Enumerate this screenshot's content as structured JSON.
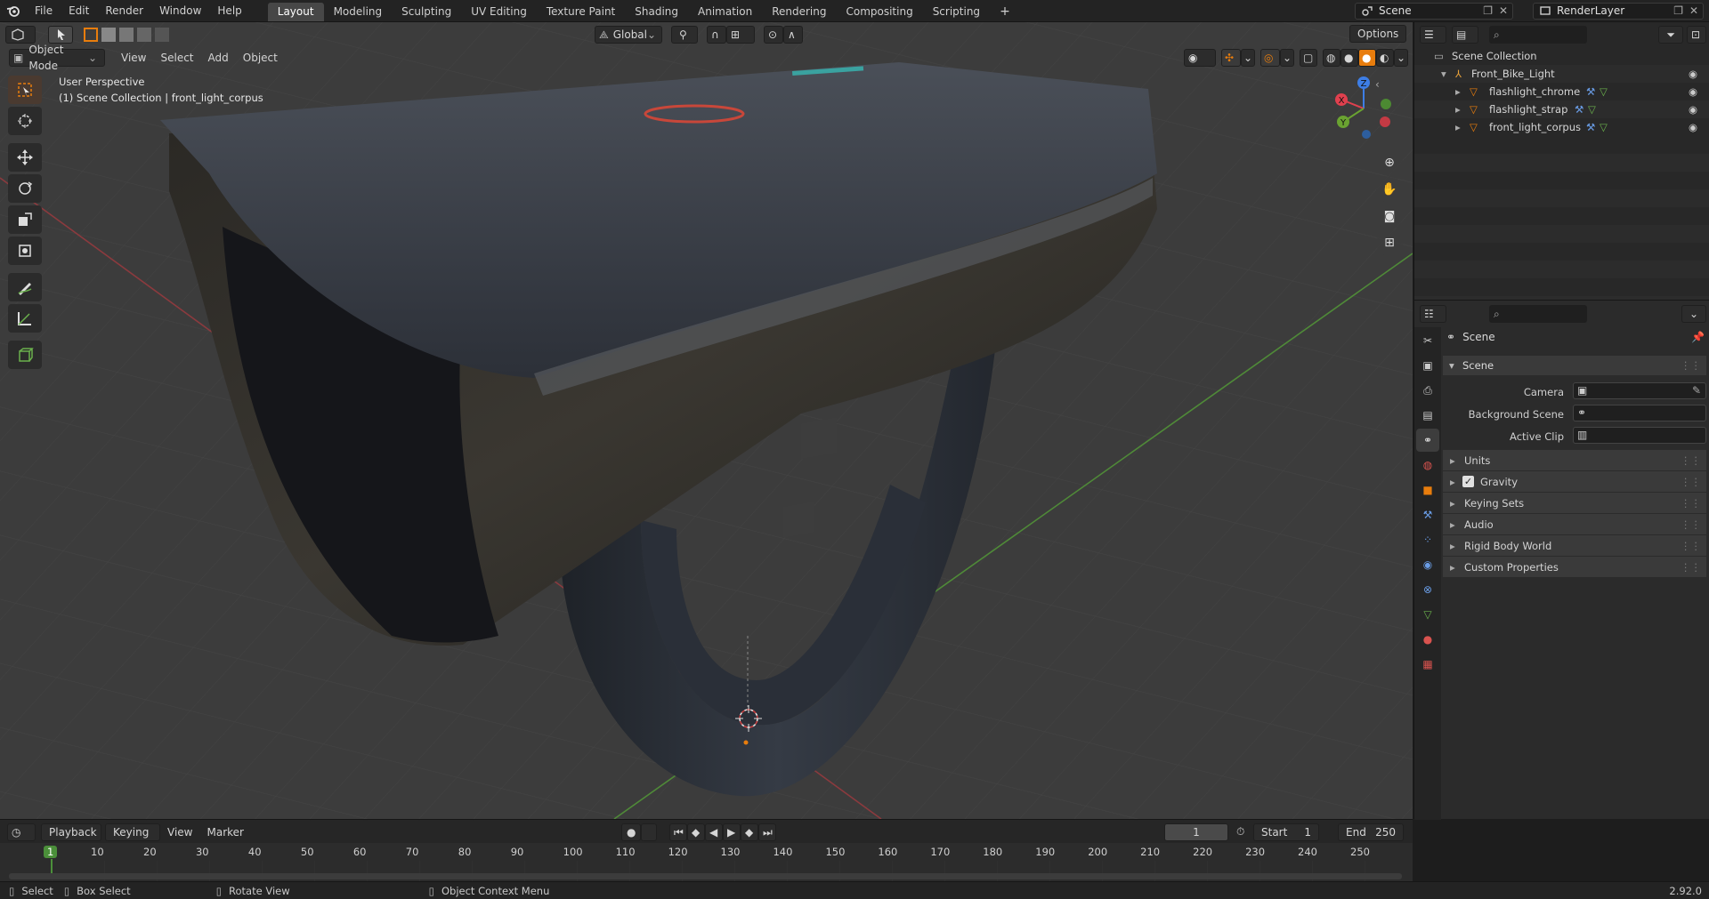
{
  "topbar": {
    "menus": [
      "File",
      "Edit",
      "Render",
      "Window",
      "Help"
    ],
    "workspaces": [
      "Layout",
      "Modeling",
      "Sculpting",
      "UV Editing",
      "Texture Paint",
      "Shading",
      "Animation",
      "Rendering",
      "Compositing",
      "Scripting"
    ],
    "active_workspace": "Layout",
    "add_tab": "+",
    "scene": "Scene",
    "view_layer": "RenderLayer"
  },
  "viewport": {
    "mode": "Object Mode",
    "menus": [
      "View",
      "Select",
      "Add",
      "Object"
    ],
    "transform_orientation": "Global",
    "options": "Options",
    "perspective_label": "User Perspective",
    "collection_label": "(1) Scene Collection | front_light_corpus",
    "gizmo_axes": {
      "x": "X",
      "y": "Y",
      "z": "Z"
    },
    "colors": {
      "x_axis": "#e0404e",
      "y_axis": "#6aa331",
      "z_axis": "#3d7ee6",
      "accent": "#e87d0d"
    }
  },
  "outliner": {
    "root": "Scene Collection",
    "collection": "Front_Bike_Light",
    "objects": [
      "flashlight_chrome",
      "flashlight_strap",
      "front_light_corpus"
    ]
  },
  "properties": {
    "context": "Scene",
    "panel": "Scene",
    "fields": {
      "camera": "Camera",
      "background_scene": "Background Scene",
      "active_clip": "Active Clip"
    },
    "subpanels": [
      "Units",
      "Gravity",
      "Keying Sets",
      "Audio",
      "Rigid Body World",
      "Custom Properties"
    ],
    "gravity_checked": true
  },
  "timeline": {
    "menus": [
      "Playback",
      "Keying",
      "View",
      "Marker"
    ],
    "current_frame": "1",
    "start_label": "Start",
    "start": "1",
    "end_label": "End",
    "end": "250",
    "ruler": [
      "1",
      "10",
      "20",
      "30",
      "40",
      "50",
      "60",
      "70",
      "80",
      "90",
      "100",
      "110",
      "120",
      "130",
      "140",
      "150",
      "160",
      "170",
      "180",
      "190",
      "200",
      "210",
      "220",
      "230",
      "240",
      "250"
    ]
  },
  "statusbar": {
    "select": "Select",
    "box_select": "Box Select",
    "rotate_view": "Rotate View",
    "context_menu": "Object Context Menu",
    "version": "2.92.0"
  }
}
